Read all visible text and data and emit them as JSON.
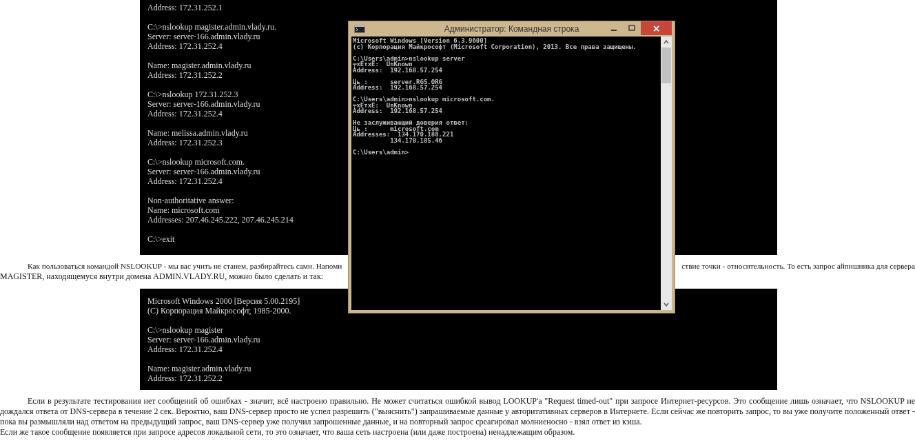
{
  "listing_top": {
    "groups": [
      [
        "Address: 172.31.252.1"
      ],
      [
        "C:\\>nslookup magister.admin.vlady.ru.",
        "Server: server-166.admin.vlady.ru",
        "Address: 172.31.252.4"
      ],
      [
        "Name: magister.admin.vlady.ru",
        "Address: 172.31.252.2"
      ],
      [
        "C:\\>nslookup 172.31.252.3",
        "Server: server-166.admin.vlady.ru",
        "Address: 172.31.252.4"
      ],
      [
        "Name: melissa.admin.vlady.ru",
        "Address: 172.31.252.3"
      ],
      [
        "C:\\>nslookup microsoft.com.",
        "Server: server-166.admin.vlady.ru",
        "Address: 172.31.252.4"
      ],
      [
        "Non-authoritative answer:",
        "Name: microsoft.com",
        "Addresses: 207.46.245.222, 207.46.245.214"
      ],
      [
        "C:\\>exit"
      ]
    ]
  },
  "paragraph_1": {
    "left_part": "Как пользоваться командой NSLOOKUP - мы вас учить не станем, разбирайтесь сами. Напоми",
    "right_part": "ствие точки - относительность. То есть запрос айпишника для сервера",
    "line_2": "MAGISTER, находящемуся внутри домена ADMIN.VLADY.RU, можно было сделать и так:"
  },
  "listing_bottom": {
    "groups": [
      [
        "Microsoft Windows 2000 [Версия 5.00.2195]",
        "(C) Корпорация Майкрософт, 1985-2000."
      ],
      [
        "C:\\>nslookup magister",
        "Server: server-166.admin.vlady.ru",
        "Address: 172.31.252.4"
      ],
      [
        "Name: magister.admin.vlady.ru",
        "Address: 172.31.252.2"
      ]
    ]
  },
  "paragraph_2": {
    "text": "Если в результате тестирования нет сообщений об ошибках - значит, всё настроено правильно. Не может считаться ошибкой вывод LOOKUP'а \"Request timed-out\" при запросе Интернет-ресурсов. Это сообщение лишь означает, что NSLOOKUP не дождался ответа от DNS-сервера в течение 2 сек. Вероятно, ваш DNS-сервер просто не успел разрешить (\"выяснить\") запрашиваемые данные у авторитативных серверов в Интернете. Если сейчас же повторить запрос, то вы уже получите положенный ответ - пока вы размышляли над ответом на предыдущий запрос, ваш DNS-сервер уже получил запрошенные данные, и на повторный запрос среагировал молниеносно - взял ответ из кэша.",
    "line_2": "Если же такое сообщение появляется при запросе адресов локальной сети, то это означает, что ваша сеть настроена (или даже построена) ненадлежащим образом."
  },
  "window": {
    "title": "Администратор: Командная строка",
    "close_label": "×",
    "groups": [
      [
        "Microsoft Windows [Version 6.3.9600]",
        "(c) Корпорация Майкрософт (Microsoft Corporation), 2013. Все права защищены."
      ],
      [
        "C:\\Users\\admin>nslookup server",
        "╤xЕтxЕ:  UnKnown",
        "Address:  192.168.57.254"
      ],
      [
        "Ць :      server.RGS.ORG",
        "Address:  192.168.57.254"
      ],
      [
        "C:\\Users\\admin>nslookup microsoft.com.",
        "╤xЕтxЕ:  UnKnown",
        "Address:  192.168.57.254"
      ],
      [
        "Не заслуживающий доверия ответ:",
        "Ць :      microsoft.com",
        "Addresses:  134.170.188.221",
        "          134.170.185.46"
      ],
      [
        "C:\\Users\\admin>"
      ]
    ]
  }
}
